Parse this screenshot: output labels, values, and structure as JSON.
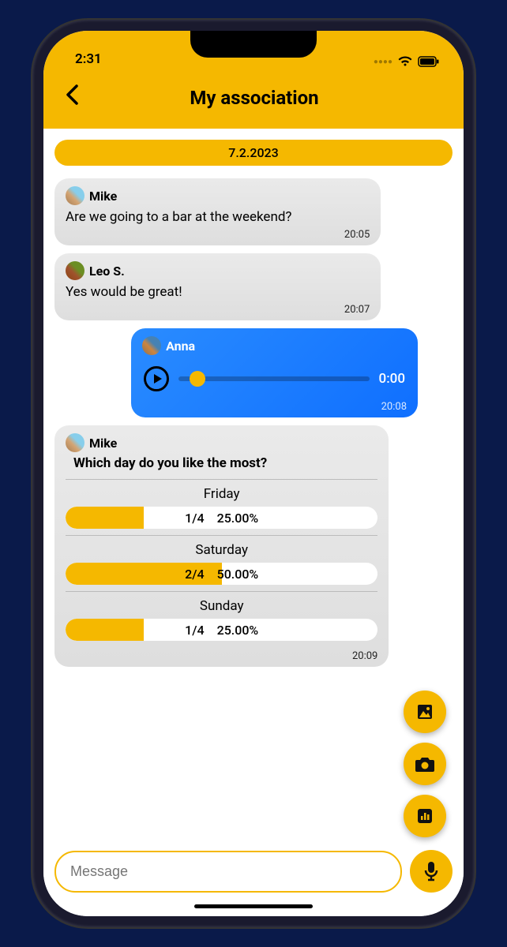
{
  "status": {
    "time": "2:31"
  },
  "header": {
    "title": "My association"
  },
  "date": "7.2.2023",
  "messages": {
    "m1": {
      "sender": "Mike",
      "text": "Are we going to a bar at the weekend?",
      "time": "20:05"
    },
    "m2": {
      "sender": "Leo S.",
      "text": "Yes would be great!",
      "time": "20:07"
    },
    "m3": {
      "sender": "Anna",
      "audio_pos": "0:00",
      "time": "20:08"
    },
    "m4": {
      "sender": "Mike",
      "question": "Which day do you like the most?",
      "options": [
        {
          "label": "Friday",
          "votes": "1/4",
          "pct": "25.00%",
          "fill": 25
        },
        {
          "label": "Saturday",
          "votes": "2/4",
          "pct": "50.00%",
          "fill": 50
        },
        {
          "label": "Sunday",
          "votes": "1/4",
          "pct": "25.00%",
          "fill": 25
        }
      ],
      "time": "20:09"
    }
  },
  "input": {
    "placeholder": "Message"
  }
}
